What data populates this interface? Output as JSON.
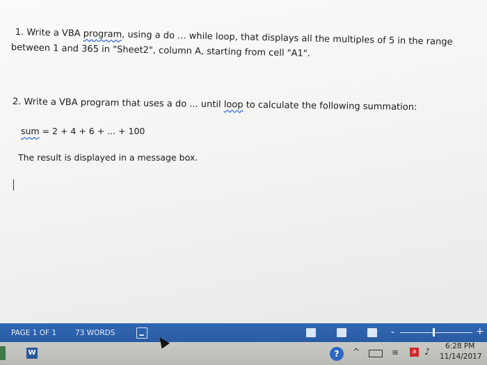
{
  "document": {
    "question1": {
      "prefix": "1. Write a VBA ",
      "flagged_word": "program",
      "comma": ",",
      "suffix": " using a do ... while loop, that displays all the multiples of 5 in the range",
      "line2": "between 1 and 365 in \"Sheet2\", column A, starting from cell \"A1\"."
    },
    "question2": {
      "prefix": "2. Write a VBA program that uses a do ... until ",
      "flagged_word": "loop",
      "suffix": " to calculate the following summation:"
    },
    "formula": {
      "flagged_word": "sum",
      "expression": " = 2 + 4 + 6 + ... + 100"
    },
    "result_line": "The result is displayed in a message box."
  },
  "status_bar": {
    "page_count": "PAGE 1 OF 1",
    "word_count": "73 WORDS",
    "zoom_minus": "-",
    "zoom_plus": "+"
  },
  "taskbar": {
    "app_letter": "W",
    "help_glyph": "?",
    "chevron": "^",
    "time": "6:28 PM",
    "date": "11/14/2017"
  },
  "icons": [
    "proofing-icon",
    "read-mode-icon",
    "print-layout-icon",
    "web-layout-icon",
    "help-icon",
    "battery-icon",
    "wifi-icon",
    "antivirus-icon",
    "volume-icon",
    "word-app-icon"
  ],
  "colors": {
    "status_bar": "#2d63ad",
    "squiggle": "#3a6fd8",
    "taskbar": "#c2c3bf"
  }
}
